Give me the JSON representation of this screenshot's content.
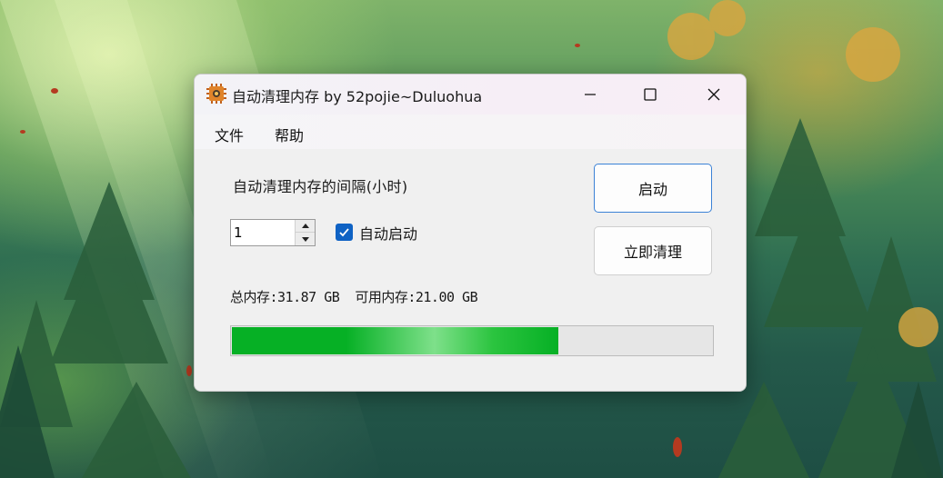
{
  "window": {
    "title": "自动清理内存 by 52pojie~Duluohua",
    "minimize_icon": "minimize-icon",
    "maximize_icon": "maximize-icon",
    "close_icon": "close-icon"
  },
  "menu": {
    "items": [
      {
        "label": "文件"
      },
      {
        "label": "帮助"
      }
    ]
  },
  "settings": {
    "interval_label": "自动清理内存的间隔(小时)",
    "interval_value": "1",
    "autostart_label": "自动启动",
    "autostart_checked": true
  },
  "buttons": {
    "start_label": "启动",
    "clean_label": "立即清理"
  },
  "memory": {
    "total_text": "总内存:31.87 GB",
    "available_text": "可用内存:21.00 GB",
    "progress_fraction": 0.68
  },
  "colors": {
    "accent": "#0f62c4",
    "progress_fill": "#06b025",
    "start_button_border": "#3b82d6"
  }
}
